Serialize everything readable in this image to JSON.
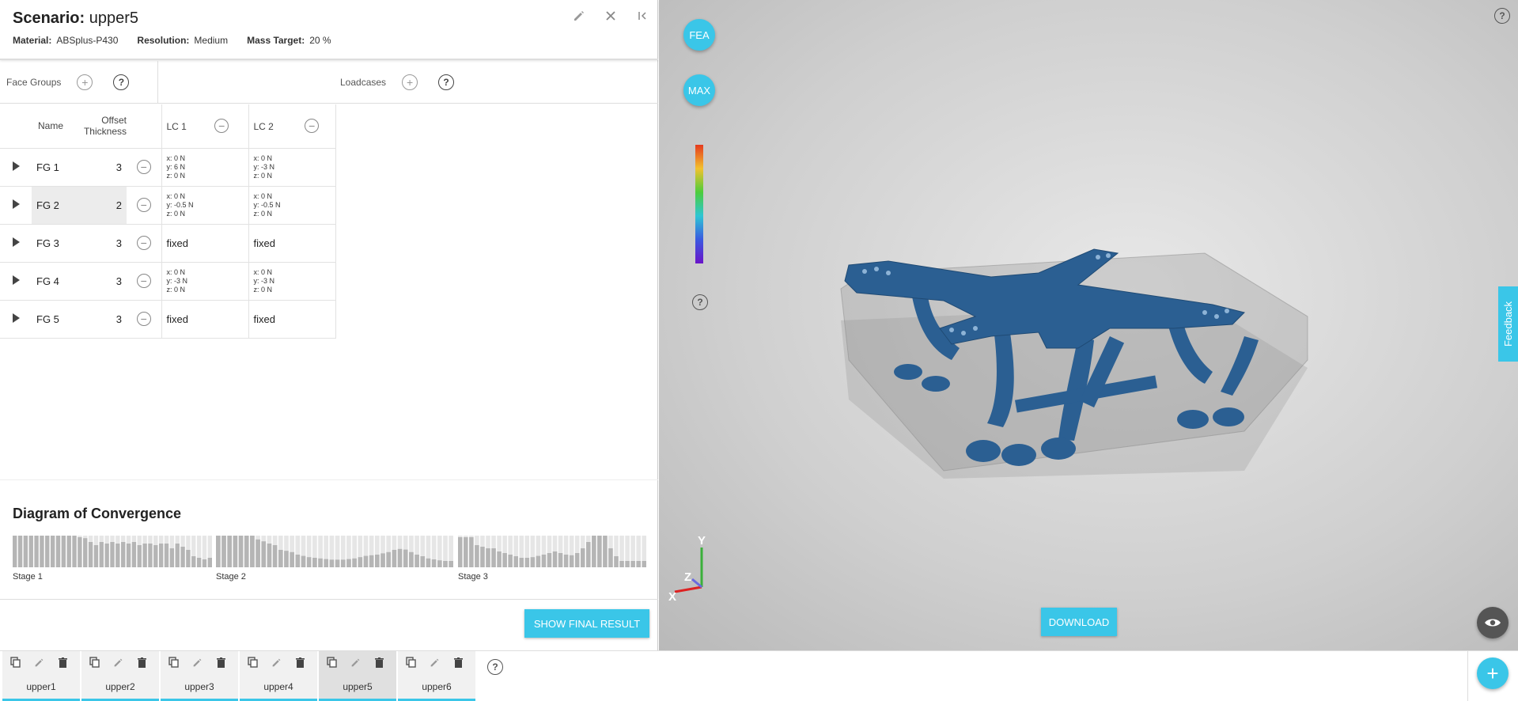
{
  "header": {
    "scenario_label": "Scenario:",
    "scenario_name": "upper5",
    "material_label": "Material:",
    "material_value": "ABSplus-P430",
    "resolution_label": "Resolution:",
    "resolution_value": "Medium",
    "mass_label": "Mass Target:",
    "mass_value": "20 %"
  },
  "face_groups": {
    "label": "Face Groups",
    "add_icon": "plus-circle-icon",
    "help_icon": "?"
  },
  "loadcases": {
    "label": "Loadcases",
    "add_icon": "plus-circle-icon",
    "help_icon": "?"
  },
  "table": {
    "col_name": "Name",
    "col_offset": "Offset Thickness",
    "lc1": "LC 1",
    "lc2": "LC 2",
    "rows": [
      {
        "name": "FG 1",
        "offset": "3",
        "lc1": [
          "x: 0 N",
          "y: 6 N",
          "z: 0 N"
        ],
        "lc2": [
          "x: 0 N",
          "y: -3 N",
          "z: 0 N"
        ]
      },
      {
        "name": "FG 2",
        "offset": "2",
        "lc1": [
          "x: 0 N",
          "y: -0.5 N",
          "z: 0 N"
        ],
        "lc2": [
          "x: 0 N",
          "y: -0.5 N",
          "z: 0 N"
        ]
      },
      {
        "name": "FG 3",
        "offset": "3",
        "lc1_text": "fixed",
        "lc2_text": "fixed"
      },
      {
        "name": "FG 4",
        "offset": "3",
        "lc1": [
          "x: 0 N",
          "y: -3 N",
          "z: 0 N"
        ],
        "lc2": [
          "x: 0 N",
          "y: -3 N",
          "z: 0 N"
        ]
      },
      {
        "name": "FG 5",
        "offset": "3",
        "lc1_text": "fixed",
        "lc2_text": "fixed"
      }
    ]
  },
  "convergence": {
    "title": "Diagram of Convergence",
    "stage1": "Stage 1",
    "stage2": "Stage 2",
    "stage3": "Stage 3",
    "stage1_fill": [
      1,
      1,
      1,
      1,
      1,
      1,
      1,
      1,
      1,
      1,
      1,
      1,
      0.95,
      0.92,
      0.8,
      0.7,
      0.8,
      0.75,
      0.8,
      0.75,
      0.8,
      0.75,
      0.8,
      0.7,
      0.75,
      0.75,
      0.7,
      0.75,
      0.75,
      0.6,
      0.75,
      0.65,
      0.55,
      0.35,
      0.3,
      0.25,
      0.3
    ],
    "stage2_fill": [
      1,
      1,
      1,
      1,
      1,
      1,
      1,
      0.88,
      0.82,
      0.75,
      0.7,
      0.55,
      0.52,
      0.48,
      0.4,
      0.36,
      0.32,
      0.3,
      0.28,
      0.26,
      0.24,
      0.24,
      0.24,
      0.26,
      0.28,
      0.32,
      0.36,
      0.38,
      0.4,
      0.44,
      0.48,
      0.55,
      0.58,
      0.56,
      0.48,
      0.4,
      0.35,
      0.28,
      0.25,
      0.22,
      0.2,
      0.2
    ],
    "stage3_fill": [
      0.95,
      0.95,
      0.95,
      0.7,
      0.65,
      0.6,
      0.6,
      0.5,
      0.45,
      0.4,
      0.35,
      0.3,
      0.3,
      0.32,
      0.36,
      0.4,
      0.45,
      0.5,
      0.45,
      0.4,
      0.38,
      0.45,
      0.6,
      0.8,
      1,
      1,
      1,
      0.6,
      0.35,
      0.2,
      0.2,
      0.2,
      0.2,
      0.2
    ],
    "bar_color": "#b5b5b5",
    "bg_color": "#e6e6e6"
  },
  "actions": {
    "show_final": "SHOW FINAL RESULT",
    "download": "DOWNLOAD"
  },
  "viewport": {
    "fea": "FEA",
    "max": "MAX",
    "feedback": "Feedback",
    "axis_x": "X",
    "axis_y": "Y",
    "axis_z": "Z",
    "model_color": "#2b5f92"
  },
  "tabs": [
    "upper1",
    "upper2",
    "upper3",
    "upper4",
    "upper5",
    "upper6"
  ],
  "active_tab": "upper5",
  "accent": "#3ac6e8"
}
